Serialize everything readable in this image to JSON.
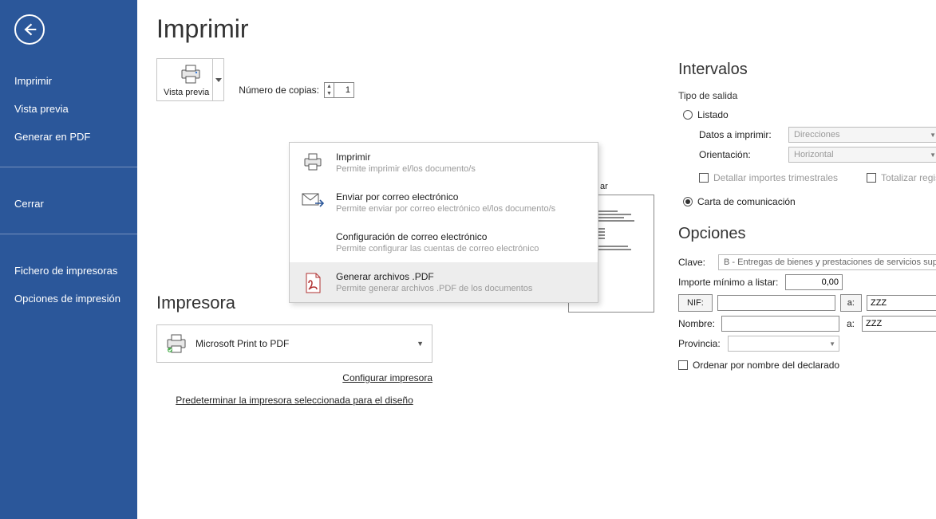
{
  "sidebar": {
    "items": [
      "Imprimir",
      "Vista previa",
      "Generar en PDF"
    ],
    "items2": [
      "Cerrar"
    ],
    "items3": [
      "Fichero de impresoras",
      "Opciones de impresión"
    ]
  },
  "header": {
    "title": "Imprimir"
  },
  "preview_button": {
    "label": "Vista previa"
  },
  "copies": {
    "label": "Número de copias:",
    "value": "1"
  },
  "dropdown": {
    "items": [
      {
        "title": "Imprimir",
        "subtitle": "Permite imprimir el/los documento/s"
      },
      {
        "title": "Enviar por correo electrónico",
        "subtitle": "Permite enviar por correo electrónico el/los documento/s"
      },
      {
        "title": "Configuración de correo electrónico",
        "subtitle": "Permite configurar las cuentas de correo electrónico"
      },
      {
        "title": "Generar archivos .PDF",
        "subtitle": "Permite generar archivos .PDF de los documentos"
      }
    ]
  },
  "impresora": {
    "heading": "Impresora",
    "name": "Microsoft Print to PDF",
    "link1": "Configurar impresora",
    "link2": "Predeterminar la impresora seleccionada para el diseño"
  },
  "intervalos": {
    "heading": "Intervalos",
    "tipo_salida": "Tipo de salida",
    "radio_listado": "Listado",
    "datos_imprimir_label": "Datos a imprimir:",
    "datos_imprimir_value": "Direcciones",
    "orientacion_label": "Orientación:",
    "orientacion_value": "Horizontal",
    "chk_detallar": "Detallar importes trimestrales",
    "chk_totalizar": "Totalizar registros",
    "radio_carta": "Carta de comunicación"
  },
  "opciones": {
    "heading": "Opciones",
    "clave_label": "Clave:",
    "clave_value": "B - Entregas de bienes y prestaciones de servicios superiores",
    "importe_label": "Importe mínimo a listar:",
    "importe_value": "0,00",
    "nif_label": "NIF:",
    "a_label": "a:",
    "nif_to_value": "ZZZ",
    "nombre_label": "Nombre:",
    "nombre_to_value": "ZZZ",
    "provincia_label": "Provincia:",
    "chk_ordenar": "Ordenar por nombre del declarado"
  }
}
